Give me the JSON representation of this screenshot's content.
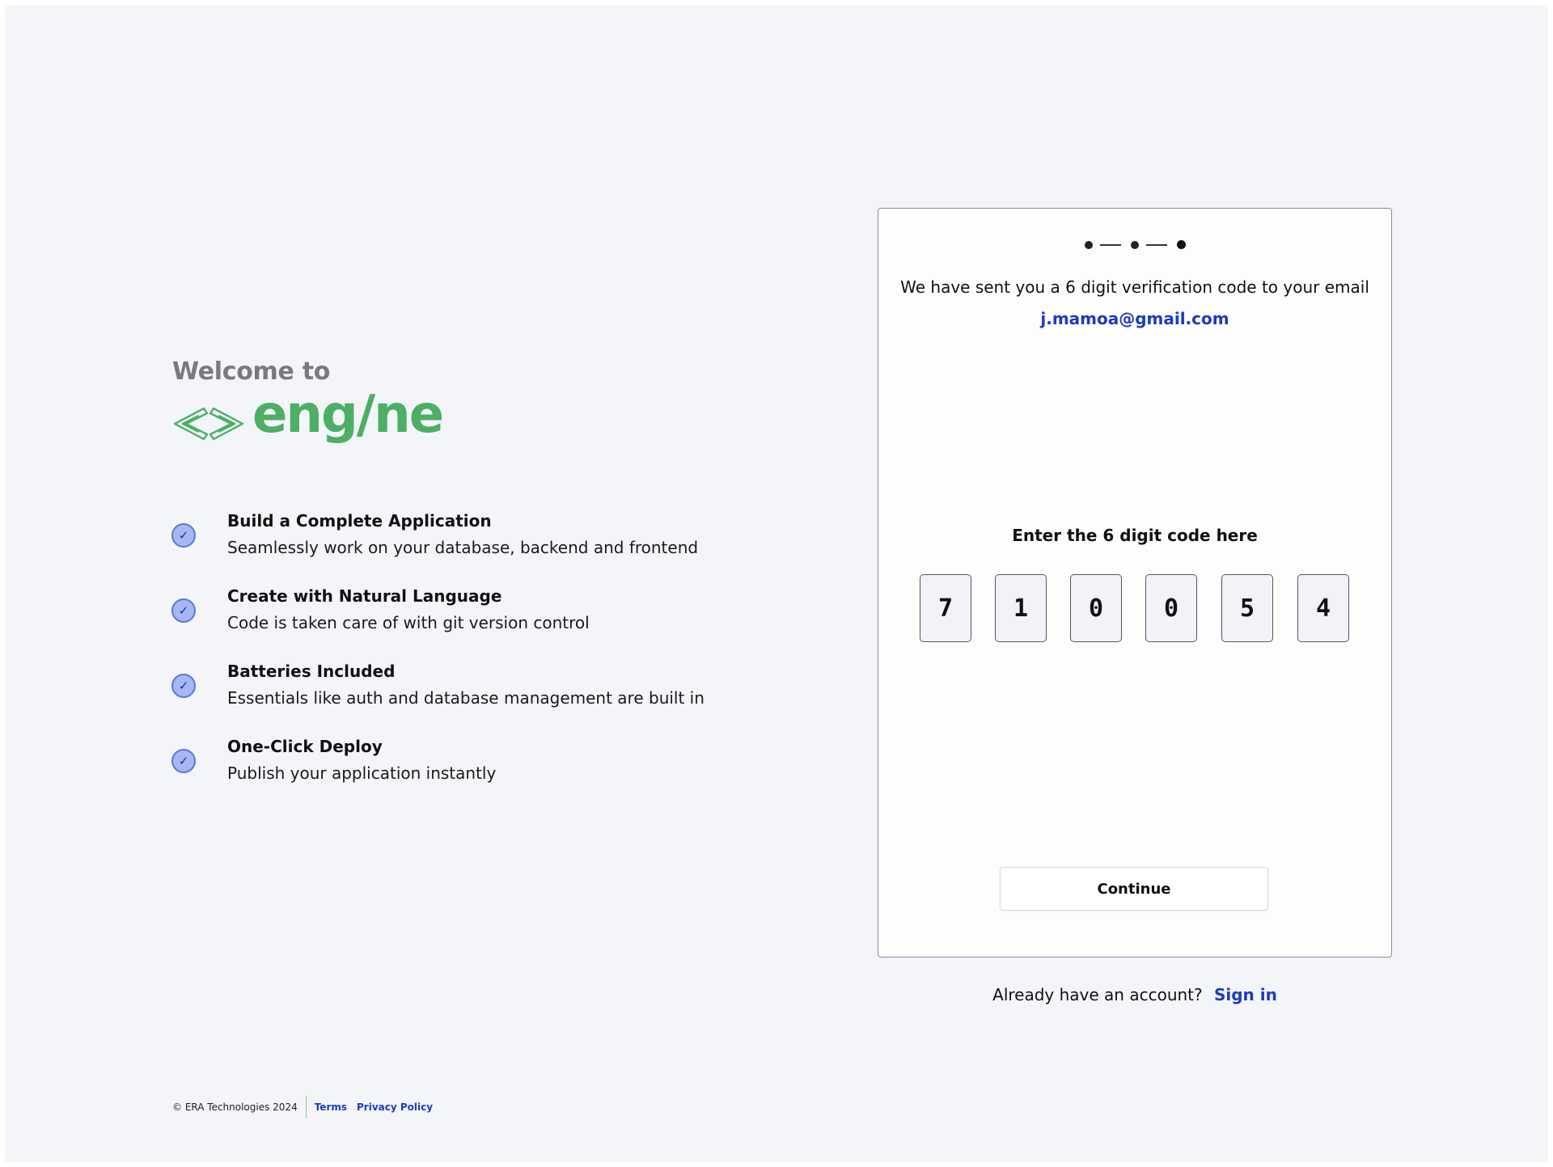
{
  "left": {
    "welcome": "Welcome to",
    "logo_text": "eng/ne",
    "features": [
      {
        "title": "Build a Complete Application",
        "desc": "Seamlessly work on your database, backend and frontend"
      },
      {
        "title": "Create with Natural Language",
        "desc": "Code is taken care of with git version control"
      },
      {
        "title": "Batteries Included",
        "desc": "Essentials like auth and database management are built in"
      },
      {
        "title": "One-Click Deploy",
        "desc": "Publish your application instantly"
      }
    ],
    "check_glyph": "✓"
  },
  "footer": {
    "copyright": "© ERA Technologies 2024",
    "terms": "Terms",
    "privacy": "Privacy Policy"
  },
  "card": {
    "steps_total": 3,
    "message": "We have sent you a 6 digit verification code to your email",
    "email": "j.mamoa@gmail.com",
    "code_label": "Enter the 6 digit code here",
    "code_digits": [
      "7",
      "1",
      "0",
      "0",
      "5",
      "4"
    ],
    "continue_label": "Continue"
  },
  "signin": {
    "prompt": "Already have an account?",
    "link": "Sign in"
  },
  "colors": {
    "brand_green": "#4caf64",
    "link_blue": "#1d3bc1",
    "check_fill": "#a6b7f4",
    "page_bg": "#f3f5f9"
  },
  "icons": {
    "logo": "code-brackets-icon",
    "feature_check": "check-circle-icon"
  }
}
